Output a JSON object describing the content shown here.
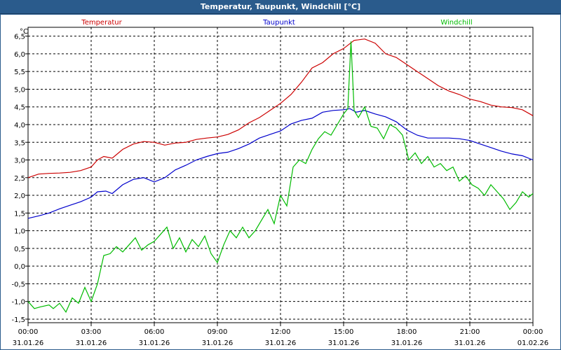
{
  "window": {
    "title": "Temperatur, Taupunkt, Windchill [°C]"
  },
  "chart_data": {
    "type": "line",
    "unit_label": "°C",
    "ylim": [
      -1.6,
      6.75
    ],
    "yticks": [
      "6,5",
      "6,0",
      "5,5",
      "5,0",
      "4,5",
      "4,0",
      "3,5",
      "3,0",
      "2,5",
      "2,0",
      "1,5",
      "1,0",
      "0,5",
      "0,0",
      "-0,5",
      "-1,0",
      "-1,5"
    ],
    "xlim": [
      0,
      24
    ],
    "xticks": [
      {
        "x": 0,
        "time": "00:00",
        "date": "31.01.26"
      },
      {
        "x": 3,
        "time": "03:00",
        "date": "31.01.26"
      },
      {
        "x": 6,
        "time": "06:00",
        "date": "31.01.26"
      },
      {
        "x": 9,
        "time": "09:00",
        "date": "31.01.26"
      },
      {
        "x": 12,
        "time": "12:00",
        "date": "31.01.26"
      },
      {
        "x": 15,
        "time": "15:00",
        "date": "31.01.26"
      },
      {
        "x": 18,
        "time": "18:00",
        "date": "31.01.26"
      },
      {
        "x": 21,
        "time": "21:00",
        "date": "31.01.26"
      },
      {
        "x": 24,
        "time": "00:00",
        "date": "01.02.26"
      }
    ],
    "grid": true,
    "series": [
      {
        "name": "Temperatur",
        "color": "#cc0000",
        "points": [
          [
            0,
            2.5
          ],
          [
            0.5,
            2.6
          ],
          [
            1,
            2.62
          ],
          [
            1.5,
            2.63
          ],
          [
            2,
            2.65
          ],
          [
            2.5,
            2.7
          ],
          [
            3,
            2.8
          ],
          [
            3.3,
            3.0
          ],
          [
            3.6,
            3.1
          ],
          [
            4,
            3.05
          ],
          [
            4.5,
            3.3
          ],
          [
            5,
            3.45
          ],
          [
            5.5,
            3.52
          ],
          [
            6,
            3.5
          ],
          [
            6.5,
            3.42
          ],
          [
            7,
            3.48
          ],
          [
            7.5,
            3.5
          ],
          [
            8,
            3.58
          ],
          [
            8.5,
            3.62
          ],
          [
            9,
            3.65
          ],
          [
            9.5,
            3.72
          ],
          [
            10,
            3.85
          ],
          [
            10.5,
            4.05
          ],
          [
            11,
            4.2
          ],
          [
            11.5,
            4.4
          ],
          [
            12,
            4.6
          ],
          [
            12.5,
            4.85
          ],
          [
            13,
            5.2
          ],
          [
            13.5,
            5.6
          ],
          [
            14,
            5.75
          ],
          [
            14.5,
            6.0
          ],
          [
            15,
            6.15
          ],
          [
            15.5,
            6.38
          ],
          [
            16,
            6.42
          ],
          [
            16.5,
            6.3
          ],
          [
            17,
            6.0
          ],
          [
            17.5,
            5.9
          ],
          [
            18,
            5.7
          ],
          [
            18.5,
            5.5
          ],
          [
            19,
            5.3
          ],
          [
            19.5,
            5.1
          ],
          [
            20,
            4.95
          ],
          [
            20.5,
            4.85
          ],
          [
            21,
            4.72
          ],
          [
            21.5,
            4.65
          ],
          [
            22,
            4.55
          ],
          [
            22.5,
            4.5
          ],
          [
            23,
            4.48
          ],
          [
            23.5,
            4.42
          ],
          [
            24,
            4.25
          ]
        ]
      },
      {
        "name": "Taupunkt",
        "color": "#0000cc",
        "points": [
          [
            0,
            1.35
          ],
          [
            0.5,
            1.42
          ],
          [
            1,
            1.5
          ],
          [
            1.5,
            1.62
          ],
          [
            2,
            1.72
          ],
          [
            2.5,
            1.82
          ],
          [
            3,
            1.95
          ],
          [
            3.3,
            2.1
          ],
          [
            3.7,
            2.12
          ],
          [
            4,
            2.05
          ],
          [
            4.5,
            2.3
          ],
          [
            5,
            2.45
          ],
          [
            5.5,
            2.5
          ],
          [
            6,
            2.38
          ],
          [
            6.5,
            2.5
          ],
          [
            7,
            2.72
          ],
          [
            7.5,
            2.85
          ],
          [
            8,
            3.0
          ],
          [
            8.5,
            3.1
          ],
          [
            9,
            3.18
          ],
          [
            9.5,
            3.22
          ],
          [
            10,
            3.32
          ],
          [
            10.5,
            3.45
          ],
          [
            11,
            3.62
          ],
          [
            11.5,
            3.72
          ],
          [
            12,
            3.82
          ],
          [
            12.5,
            4.02
          ],
          [
            13,
            4.12
          ],
          [
            13.5,
            4.18
          ],
          [
            14,
            4.35
          ],
          [
            14.5,
            4.4
          ],
          [
            15,
            4.42
          ],
          [
            15.3,
            4.45
          ],
          [
            15.6,
            4.35
          ],
          [
            16,
            4.4
          ],
          [
            16.5,
            4.3
          ],
          [
            17,
            4.22
          ],
          [
            17.5,
            4.08
          ],
          [
            18,
            3.85
          ],
          [
            18.5,
            3.7
          ],
          [
            19,
            3.62
          ],
          [
            19.5,
            3.62
          ],
          [
            20,
            3.62
          ],
          [
            20.5,
            3.6
          ],
          [
            21,
            3.55
          ],
          [
            21.5,
            3.45
          ],
          [
            22,
            3.35
          ],
          [
            22.5,
            3.25
          ],
          [
            23,
            3.17
          ],
          [
            23.5,
            3.12
          ],
          [
            24,
            3.0
          ]
        ]
      },
      {
        "name": "Windchill",
        "color": "#00bb00",
        "points": [
          [
            0,
            -1.0
          ],
          [
            0.3,
            -1.2
          ],
          [
            0.6,
            -1.15
          ],
          [
            1,
            -1.1
          ],
          [
            1.2,
            -1.2
          ],
          [
            1.5,
            -1.05
          ],
          [
            1.8,
            -1.3
          ],
          [
            2.1,
            -0.9
          ],
          [
            2.4,
            -1.05
          ],
          [
            2.7,
            -0.6
          ],
          [
            3,
            -1.0
          ],
          [
            3.3,
            -0.5
          ],
          [
            3.6,
            0.3
          ],
          [
            3.9,
            0.35
          ],
          [
            4.2,
            0.55
          ],
          [
            4.5,
            0.4
          ],
          [
            4.8,
            0.6
          ],
          [
            5.1,
            0.8
          ],
          [
            5.4,
            0.45
          ],
          [
            5.7,
            0.6
          ],
          [
            6,
            0.7
          ],
          [
            6.3,
            0.9
          ],
          [
            6.6,
            1.1
          ],
          [
            6.9,
            0.5
          ],
          [
            7.2,
            0.8
          ],
          [
            7.5,
            0.4
          ],
          [
            7.8,
            0.75
          ],
          [
            8.1,
            0.55
          ],
          [
            8.4,
            0.85
          ],
          [
            8.7,
            0.35
          ],
          [
            9,
            0.1
          ],
          [
            9.3,
            0.6
          ],
          [
            9.6,
            1.0
          ],
          [
            9.9,
            0.8
          ],
          [
            10.2,
            1.1
          ],
          [
            10.5,
            0.8
          ],
          [
            10.8,
            1.0
          ],
          [
            11.1,
            1.3
          ],
          [
            11.4,
            1.6
          ],
          [
            11.7,
            1.2
          ],
          [
            12,
            2.0
          ],
          [
            12.3,
            1.7
          ],
          [
            12.6,
            2.8
          ],
          [
            12.9,
            3.0
          ],
          [
            13.2,
            2.9
          ],
          [
            13.5,
            3.3
          ],
          [
            13.8,
            3.6
          ],
          [
            14.1,
            3.8
          ],
          [
            14.4,
            3.7
          ],
          [
            14.7,
            4.0
          ],
          [
            15,
            4.3
          ],
          [
            15.2,
            4.45
          ],
          [
            15.35,
            6.35
          ],
          [
            15.5,
            4.4
          ],
          [
            15.7,
            4.2
          ],
          [
            16,
            4.5
          ],
          [
            16.3,
            3.95
          ],
          [
            16.6,
            3.9
          ],
          [
            16.9,
            3.6
          ],
          [
            17.2,
            4.0
          ],
          [
            17.5,
            3.9
          ],
          [
            17.8,
            3.7
          ],
          [
            18.1,
            3.0
          ],
          [
            18.4,
            3.2
          ],
          [
            18.7,
            2.9
          ],
          [
            19,
            3.1
          ],
          [
            19.3,
            2.8
          ],
          [
            19.6,
            2.9
          ],
          [
            19.9,
            2.7
          ],
          [
            20.2,
            2.8
          ],
          [
            20.5,
            2.4
          ],
          [
            20.8,
            2.55
          ],
          [
            21.1,
            2.3
          ],
          [
            21.4,
            2.2
          ],
          [
            21.7,
            2.0
          ],
          [
            22,
            2.3
          ],
          [
            22.3,
            2.1
          ],
          [
            22.6,
            1.9
          ],
          [
            22.9,
            1.6
          ],
          [
            23.2,
            1.8
          ],
          [
            23.5,
            2.1
          ],
          [
            23.8,
            1.95
          ],
          [
            24,
            2.05
          ]
        ]
      }
    ]
  }
}
